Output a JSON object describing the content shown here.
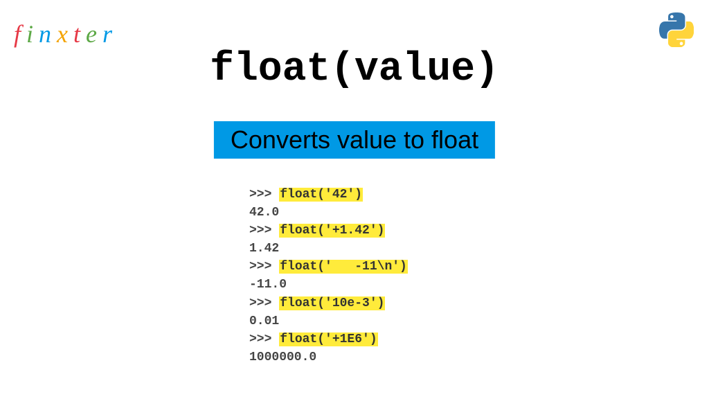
{
  "logo": {
    "letters": [
      "f",
      "i",
      "n",
      "x",
      "t",
      "e",
      "r"
    ]
  },
  "title": "float(value)",
  "banner": "Converts value to float",
  "code": {
    "prompt": ">>> ",
    "lines": [
      {
        "call": "float('42')",
        "output": "42.0"
      },
      {
        "call": "float('+1.42')",
        "output": "1.42"
      },
      {
        "call": "float('   -11\\n')",
        "output": "-11.0"
      },
      {
        "call": "float('10e-3')",
        "output": "0.01"
      },
      {
        "call": "float('+1E6')",
        "output": "1000000.0"
      }
    ]
  }
}
